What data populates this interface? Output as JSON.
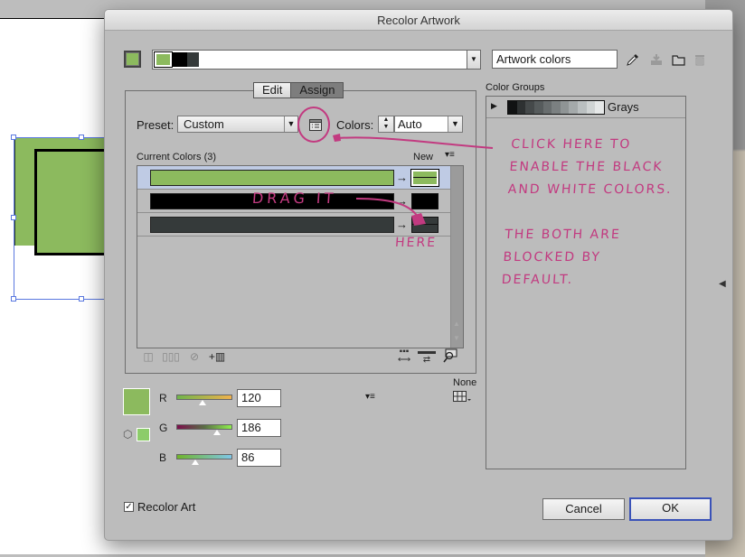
{
  "window": {
    "title": "Recolor Artwork"
  },
  "colors": {
    "green": "#8cba5e",
    "black": "#000000",
    "dark_gray": "#353a3a",
    "selection_blue": "#5a78e0",
    "annotation": "#c23a80",
    "ok_border": "#3a52b8"
  },
  "top_bar": {
    "harmony_colors": [
      "#8cba5e",
      "#000000",
      "#353a3a"
    ],
    "group_name_value": "Artwork colors",
    "icons": [
      "eyedropper-icon",
      "save-group-icon",
      "folder-icon",
      "trash-icon"
    ]
  },
  "tabs": [
    {
      "label": "Edit",
      "active": false
    },
    {
      "label": "Assign",
      "active": true
    }
  ],
  "assign": {
    "preset_label": "Preset:",
    "preset_value": "Custom",
    "colors_label": "Colors:",
    "colors_value": "Auto",
    "current_colors_label": "Current Colors (3)",
    "new_label": "New",
    "rows": [
      {
        "current": "#8cba5e",
        "new": "#8cba5e",
        "selected": true
      },
      {
        "current": "#000000",
        "new": "#000000",
        "selected": false
      },
      {
        "current": "#353a3a",
        "new": "#353a3a",
        "selected": false
      }
    ]
  },
  "editor": {
    "none_label": "None",
    "swatch": "#8cba5e",
    "gamut_swatch": "#8ccc6a",
    "channels": [
      {
        "label": "R",
        "value": "120",
        "fraction": 0.47
      },
      {
        "label": "G",
        "value": "186",
        "fraction": 0.73
      },
      {
        "label": "B",
        "value": "86",
        "fraction": 0.34
      }
    ]
  },
  "color_groups": {
    "label": "Color Groups",
    "groups": [
      {
        "name": "Grays",
        "swatches": [
          "#111213",
          "#2e3132",
          "#45494a",
          "#565b5c",
          "#686d6e",
          "#7b8081",
          "#8f9495",
          "#a4a9aa",
          "#babfc0",
          "#d0d4d4",
          "#e6e8e8"
        ]
      }
    ]
  },
  "footer": {
    "recolor_art_label": "Recolor Art",
    "recolor_art_checked": true,
    "cancel_label": "Cancel",
    "ok_label": "OK"
  },
  "annotations": {
    "drag_it": "DRAG IT",
    "here": "HERE",
    "note_lines": [
      "CLICK HERE TO",
      "ENABLE THE BLACK",
      "AND WHITE COLORS.",
      "",
      "THE BOTH ARE",
      "BLOCKED BY",
      "DEFAULT."
    ]
  }
}
